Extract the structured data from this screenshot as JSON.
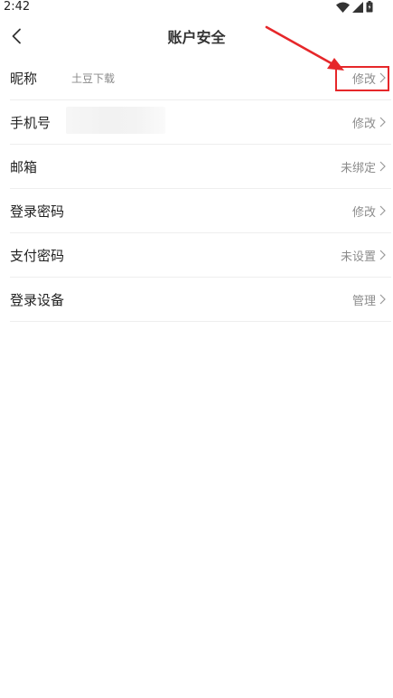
{
  "status_bar": {
    "time": "2:42"
  },
  "header": {
    "title": "账户安全"
  },
  "rows": [
    {
      "label": "昵称",
      "sub": "土豆下载",
      "action": "修改"
    },
    {
      "label": "手机号",
      "action": "修改"
    },
    {
      "label": "邮箱",
      "action": "未绑定"
    },
    {
      "label": "登录密码",
      "action": "修改"
    },
    {
      "label": "支付密码",
      "action": "未设置"
    },
    {
      "label": "登录设备",
      "action": "管理"
    }
  ],
  "colors": {
    "highlight": "#e6272a",
    "divider": "#eeeeee",
    "secondary_text": "#8c8c8c"
  },
  "icons": [
    "wifi-icon",
    "signal-icon",
    "battery-icon",
    "back-arrow-icon",
    "chevron-right-icon"
  ]
}
